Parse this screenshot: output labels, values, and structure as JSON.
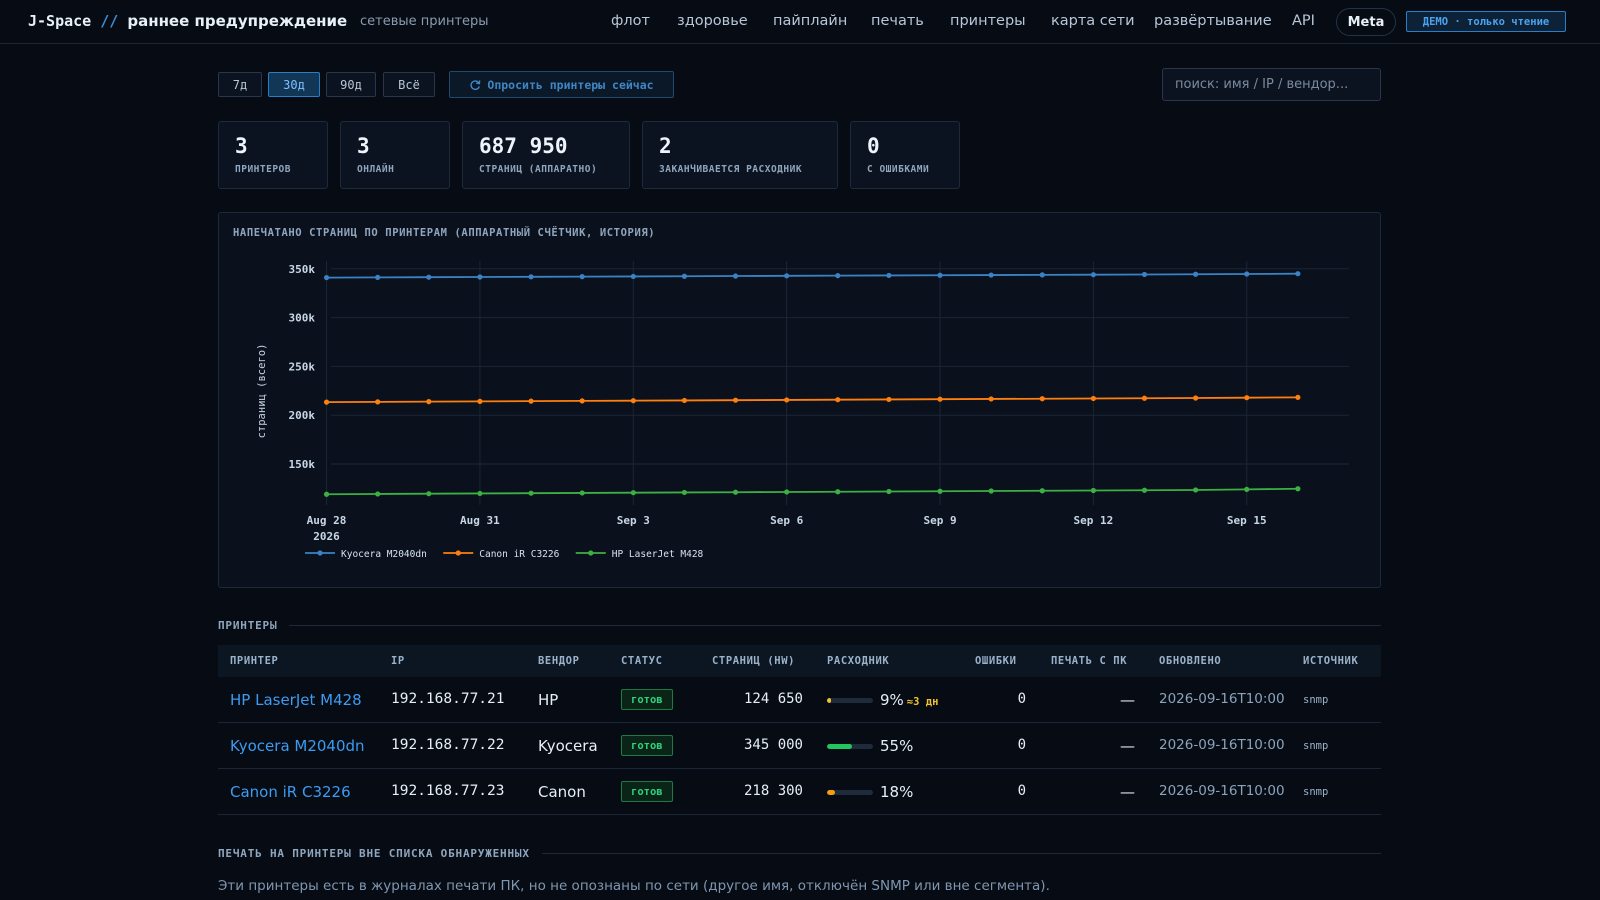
{
  "header": {
    "brand_name": "J-Space",
    "brand_slashes": "//",
    "brand_subtitle": "раннее предупреждение",
    "brand_tag": "сетевые принтеры",
    "nav": [
      "флот",
      "здоровье",
      "пайплайн",
      "печать",
      "принтеры",
      "карта сети",
      "развёртывание",
      "API"
    ],
    "meta_button": "Meta",
    "demo_badge": "ДЕМО · только чтение"
  },
  "controls": {
    "ranges": [
      "7д",
      "30д",
      "90д",
      "Всё"
    ],
    "active_range": "30д",
    "poll_icon": "refresh-icon",
    "poll_label": "Опросить принтеры сейчас",
    "search_placeholder": "поиск: имя / IP / вендор..."
  },
  "kpis": [
    {
      "value": "3",
      "label": "ПРИНТЕРОВ"
    },
    {
      "value": "3",
      "label": "ОНЛАЙН"
    },
    {
      "value": "687 950",
      "label": "СТРАНИЦ (АППАРАТНО)"
    },
    {
      "value": "2",
      "label": "ЗАКАНЧИВАЕТСЯ РАСХОДНИК"
    },
    {
      "value": "0",
      "label": "С ОШИБКАМИ"
    }
  ],
  "chart_data": {
    "type": "line",
    "title": "НАПЕЧАТАНО СТРАНИЦ ПО ПРИНТЕРАМ (АППАРАТНЫЙ СЧЁТЧИК, ИСТОРИЯ)",
    "ylabel": "страниц (всего)",
    "x_ticks": [
      "Aug 28",
      "Aug 31",
      "Sep 3",
      "Sep 6",
      "Sep 9",
      "Sep 12",
      "Sep 15"
    ],
    "x_year_label": "2026",
    "y_ticks": [
      "150k",
      "200k",
      "250k",
      "300k",
      "350k"
    ],
    "ylim": [
      108000,
      358000
    ],
    "x": [
      "2026-08-28",
      "2026-08-29",
      "2026-08-30",
      "2026-08-31",
      "2026-09-01",
      "2026-09-02",
      "2026-09-03",
      "2026-09-04",
      "2026-09-05",
      "2026-09-06",
      "2026-09-07",
      "2026-09-08",
      "2026-09-09",
      "2026-09-10",
      "2026-09-11",
      "2026-09-12",
      "2026-09-13",
      "2026-09-14",
      "2026-09-15",
      "2026-09-16"
    ],
    "grid": true,
    "legend_position": "bottom-left",
    "series": [
      {
        "name": "Kyocera M2040dn",
        "color": "#3b82c4",
        "values": [
          341000,
          341200,
          341400,
          341600,
          341800,
          342000,
          342200,
          342400,
          342600,
          342800,
          343000,
          343200,
          343400,
          343600,
          343800,
          344000,
          344200,
          344400,
          344700,
          345000
        ]
      },
      {
        "name": "Canon iR C3226",
        "color": "#ff7f0e",
        "values": [
          213400,
          213650,
          213900,
          214150,
          214400,
          214650,
          214900,
          215150,
          215400,
          215650,
          215900,
          216150,
          216400,
          216650,
          216900,
          217150,
          217400,
          217650,
          217950,
          218300
        ]
      },
      {
        "name": "HP LaserJet M428",
        "color": "#3cb043",
        "values": [
          119000,
          119300,
          119600,
          119850,
          120100,
          120350,
          120600,
          120850,
          121100,
          121350,
          121600,
          121850,
          122100,
          122350,
          122600,
          122850,
          123100,
          123400,
          124000,
          124650
        ]
      }
    ]
  },
  "printers_section": {
    "title": "ПРИНТЕРЫ",
    "columns": [
      "ПРИНТЕР",
      "IP",
      "ВЕНДОР",
      "СТАТУС",
      "СТРАНИЦ (HW)",
      "РАСХОДНИК",
      "ОШИБКИ",
      "ПЕЧАТЬ С ПК",
      "ОБНОВЛЕНО",
      "ИСТОЧНИК"
    ],
    "rows": [
      {
        "name": "HP LaserJet M428",
        "ip": "192.168.77.21",
        "vendor": "HP",
        "status": "готов",
        "pages": "124 650",
        "supply_pct": "9%",
        "supply_level": 0.09,
        "supply_color": "#f2c230",
        "supply_warn": "≈3 дн",
        "errors": "0",
        "pc_print": "—",
        "updated": "2026-09-16T10:00",
        "source": "snmp"
      },
      {
        "name": "Kyocera M2040dn",
        "ip": "192.168.77.22",
        "vendor": "Kyocera",
        "status": "готов",
        "pages": "345 000",
        "supply_pct": "55%",
        "supply_level": 0.55,
        "supply_color": "#22c55e",
        "supply_warn": "",
        "errors": "0",
        "pc_print": "—",
        "updated": "2026-09-16T10:00",
        "source": "snmp"
      },
      {
        "name": "Canon iR C3226",
        "ip": "192.168.77.23",
        "vendor": "Canon",
        "status": "готов",
        "pages": "218 300",
        "supply_pct": "18%",
        "supply_level": 0.18,
        "supply_color": "#f59e0b",
        "supply_warn": "",
        "errors": "0",
        "pc_print": "—",
        "updated": "2026-09-16T10:00",
        "source": "snmp"
      }
    ]
  },
  "unlisted_section": {
    "title": "ПЕЧАТЬ НА ПРИНТЕРЫ ВНЕ СПИСКА ОБНАРУЖЕННЫХ",
    "note": "Эти принтеры есть в журналах печати ПК, но не опознаны по сети (другое имя, отключён SNMP или вне сегмента)."
  }
}
